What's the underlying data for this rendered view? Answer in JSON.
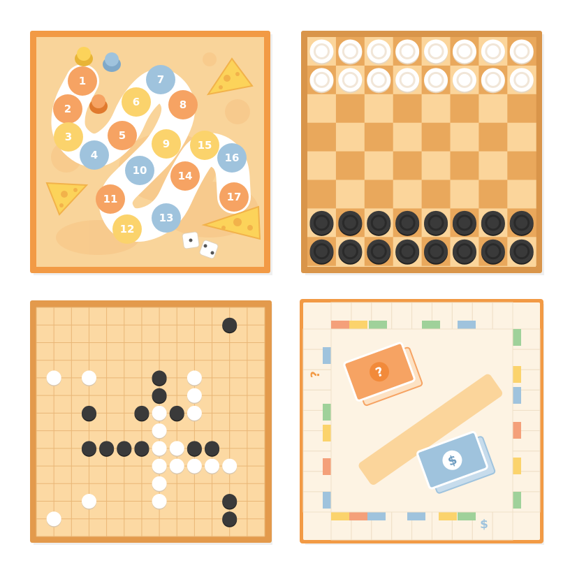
{
  "panels": {
    "snakes": {
      "numbers": [
        "1",
        "2",
        "3",
        "4",
        "5",
        "6",
        "7",
        "8",
        "9",
        "10",
        "11",
        "12",
        "13",
        "14",
        "15",
        "16",
        "17"
      ],
      "colors": {
        "frame": "#f29a45",
        "board": "#f9d49a",
        "blob": "#f7c88a",
        "orange": "#f6a363",
        "yellow": "#fbd36c",
        "blue": "#9fc3dd",
        "cheese": "#fcd35a"
      }
    },
    "checkers": {
      "rows": 8,
      "cols": 8,
      "white_rows": 2,
      "black_rows": 2,
      "colors": {
        "frame": "#d9954a",
        "light": "#fbd59b",
        "dark": "#e9a85c",
        "white_piece": "#ffffff",
        "black_piece": "#3a3a3a"
      }
    },
    "gomoku": {
      "grid": 13,
      "stones": [
        {
          "c": "b",
          "col": 11,
          "row": 1
        },
        {
          "c": "w",
          "col": 1,
          "row": 4
        },
        {
          "c": "w",
          "col": 3,
          "row": 4
        },
        {
          "c": "b",
          "col": 7,
          "row": 4
        },
        {
          "c": "w",
          "col": 9,
          "row": 4
        },
        {
          "c": "b",
          "col": 7,
          "row": 5
        },
        {
          "c": "w",
          "col": 9,
          "row": 5
        },
        {
          "c": "b",
          "col": 3,
          "row": 6
        },
        {
          "c": "b",
          "col": 6,
          "row": 6
        },
        {
          "c": "w",
          "col": 7,
          "row": 6
        },
        {
          "c": "b",
          "col": 8,
          "row": 6
        },
        {
          "c": "w",
          "col": 9,
          "row": 6
        },
        {
          "c": "w",
          "col": 7,
          "row": 7
        },
        {
          "c": "b",
          "col": 3,
          "row": 8
        },
        {
          "c": "b",
          "col": 4,
          "row": 8
        },
        {
          "c": "b",
          "col": 5,
          "row": 8
        },
        {
          "c": "b",
          "col": 6,
          "row": 8
        },
        {
          "c": "w",
          "col": 7,
          "row": 8
        },
        {
          "c": "w",
          "col": 8,
          "row": 8
        },
        {
          "c": "b",
          "col": 9,
          "row": 8
        },
        {
          "c": "b",
          "col": 10,
          "row": 8
        },
        {
          "c": "w",
          "col": 7,
          "row": 9
        },
        {
          "c": "w",
          "col": 8,
          "row": 9
        },
        {
          "c": "w",
          "col": 9,
          "row": 9
        },
        {
          "c": "w",
          "col": 10,
          "row": 9
        },
        {
          "c": "w",
          "col": 11,
          "row": 9
        },
        {
          "c": "w",
          "col": 7,
          "row": 10
        },
        {
          "c": "w",
          "col": 3,
          "row": 11
        },
        {
          "c": "w",
          "col": 7,
          "row": 11
        },
        {
          "c": "b",
          "col": 11,
          "row": 11
        },
        {
          "c": "w",
          "col": 1,
          "row": 12
        },
        {
          "c": "b",
          "col": 11,
          "row": 12
        }
      ],
      "colors": {
        "frame": "#e39a4c",
        "board": "#fcd9a3",
        "line": "#e9b676"
      }
    },
    "monopoly": {
      "chance_symbol": "?",
      "money_symbol": "$",
      "colors": {
        "frame": "#f29a45",
        "board": "#fdf3e3",
        "orange_card": "#f6a363",
        "blue_card": "#9fc3dd",
        "bar": "#fbd59b",
        "green": "#9fd19a",
        "yellow": "#fbd36c",
        "red": "#f4a07a"
      }
    }
  }
}
